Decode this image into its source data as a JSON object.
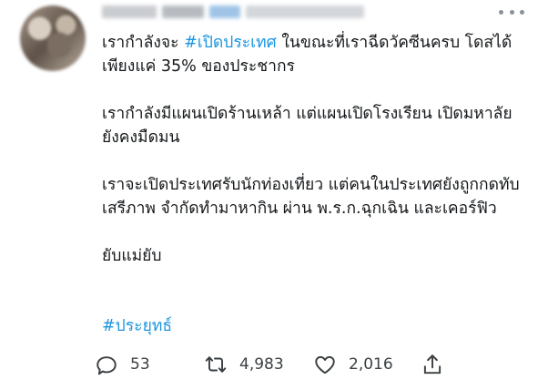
{
  "tweet": {
    "paragraphs": [
      {
        "before": "เรากำลังจะ ",
        "hashtag": "#เปิดประเทศ",
        "after": " ในขณะที่เราฉีดวัคซีนครบ โดสได้เพียงแค่ 35% ของประชากร"
      },
      {
        "text": "เรากำลังมีแผนเปิดร้านเหล้า แต่แผนเปิดโรงเรียน เปิดมหาลัย ยังคงมืดมน"
      },
      {
        "text": "เราจะเปิดประเทศรับนักท่องเที่ยว แต่คนในประเทศยังถูกกดทับเสรีภาพ จำกัดทำมาหากิน ผ่าน พ.ร.ก.ฉุกเฉิน และเคอร์ฟิว"
      },
      {
        "text": "ยับแม่ยับ"
      }
    ],
    "footer_hashtag": "#ประยุทธ์"
  },
  "actions": {
    "reply_count": "53",
    "retweet_count": "4,983",
    "like_count": "2,016"
  },
  "icons": {
    "reply": "reply-icon",
    "retweet": "retweet-icon",
    "like": "heart-icon",
    "share": "share-icon",
    "more": "more-options-icon"
  },
  "colors": {
    "hashtag": "#1b95e0",
    "text": "#14171a",
    "icon": "#3c4043"
  }
}
